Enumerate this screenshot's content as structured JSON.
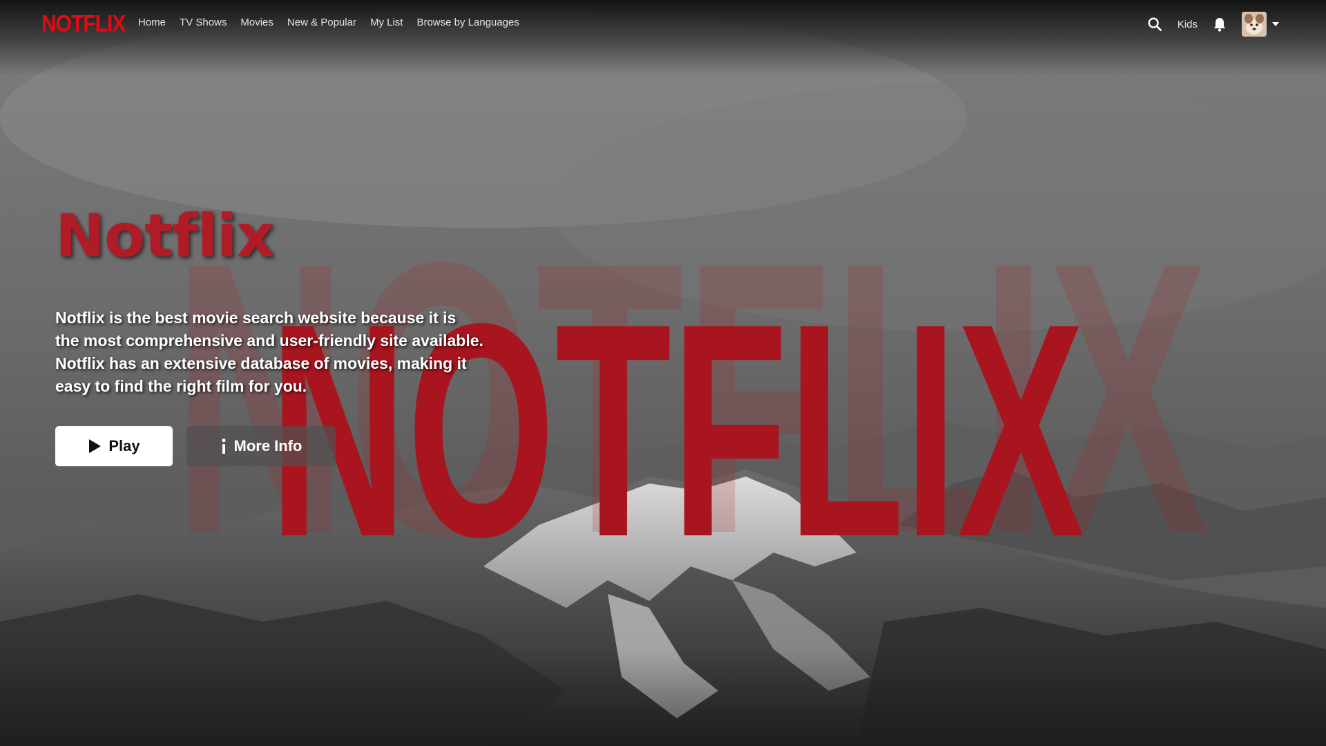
{
  "brand": {
    "logo_text": "NOTFLIX",
    "color": "#e50914"
  },
  "nav": {
    "links": [
      {
        "label": "Home"
      },
      {
        "label": "TV Shows"
      },
      {
        "label": "Movies"
      },
      {
        "label": "New & Popular"
      },
      {
        "label": "My List"
      },
      {
        "label": "Browse by Languages"
      }
    ],
    "kids_label": "Kids",
    "icons": {
      "search": "search-icon",
      "notifications": "bell-icon",
      "profile_menu": "caret-down-icon"
    }
  },
  "hero": {
    "background_logo_text": "NOTFLIX",
    "title": "Notflix",
    "title_color": "#b01c25",
    "description": "Notflix is the best movie search website because it is the most comprehensive and user-friendly site available. Notflix has an extensive database of movies, making it easy to find the right film for you.",
    "play_label": "Play",
    "more_info_label": "More Info",
    "play_icon": "play-icon",
    "info_icon": "info-icon"
  }
}
